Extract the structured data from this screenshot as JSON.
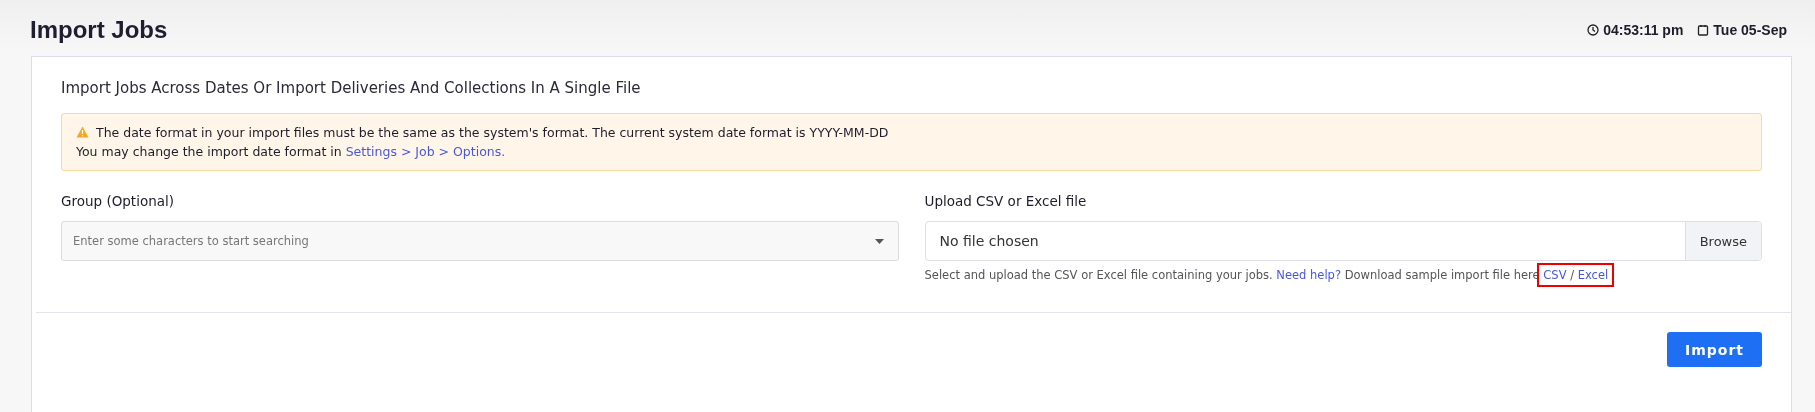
{
  "page": {
    "title": "Import Jobs",
    "time": "04:53:11 pm",
    "date": "Tue 05-Sep"
  },
  "card": {
    "heading": "Import Jobs Across Dates Or Import Deliveries And Collections In A Single File",
    "alert": {
      "line_1": "The date format in your import files must be the same as the system's format. The current system date format is YYYY-MM-DD",
      "line_2": "You may change the import date format in",
      "link": "Settings > Job > Options."
    },
    "group": {
      "label": "Group (Optional)",
      "placeholder": "Enter some characters to start searching"
    },
    "upload": {
      "label": "Upload CSV or Excel file",
      "value": "No file chosen",
      "button": "Browse",
      "help": {
        "text": "Select and upload the CSV or Excel file containing your jobs.",
        "help_link": "Need help?",
        "sample_text": "Download sample import file here",
        "csv_link": "CSV",
        "separator": "/",
        "excel_link": "Excel",
        "highlighted": true
      }
    },
    "submit": "Import"
  }
}
